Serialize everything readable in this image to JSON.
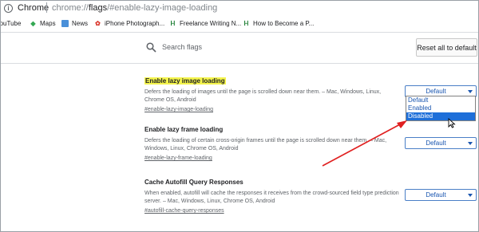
{
  "browser": {
    "site_label": "Chrome",
    "url_prefix": "chrome://",
    "url_host": "flags",
    "url_path": "/#enable-lazy-image-loading"
  },
  "bookmarks": [
    {
      "label": "YouTube",
      "icon": "youtube-icon"
    },
    {
      "label": "Maps",
      "icon": "maps-icon"
    },
    {
      "label": "News",
      "icon": "news-icon"
    },
    {
      "label": "iPhone Photograph...",
      "icon": "flower-icon"
    },
    {
      "label": "Freelance Writing N...",
      "icon": "hw-icon"
    },
    {
      "label": "How to Become a P...",
      "icon": "hw-icon"
    }
  ],
  "header": {
    "search_placeholder": "Search flags",
    "reset_label": "Reset all to default"
  },
  "flags": [
    {
      "title": "Enable lazy image loading",
      "desc": "Defers the loading of images until the page is scrolled down near them. – Mac, Windows, Linux, Chrome OS, Android",
      "link": "#enable-lazy-image-loading",
      "value": "Default"
    },
    {
      "title": "Enable lazy frame loading",
      "desc": "Defers the loading of certain cross-origin frames until the page is scrolled down near them. – Mac, Windows, Linux, Chrome OS, Android",
      "link": "#enable-lazy-frame-loading",
      "value": "Default"
    },
    {
      "title": "Cache Autofill Query Responses",
      "desc": "When enabled, autofill will cache the responses it receives from the crowd-sourced field type prediction server. – Mac, Windows, Linux, Chrome OS, Android",
      "link": "#autofill-cache-query-responses",
      "value": "Default"
    }
  ],
  "dropdown_options": [
    "Default",
    "Enabled",
    "Disabled"
  ],
  "dropdown_selected": "Disabled",
  "colors": {
    "highlight": "#f4f44c",
    "arrow": "#e02020",
    "select_accent": "#1e6fd9"
  }
}
